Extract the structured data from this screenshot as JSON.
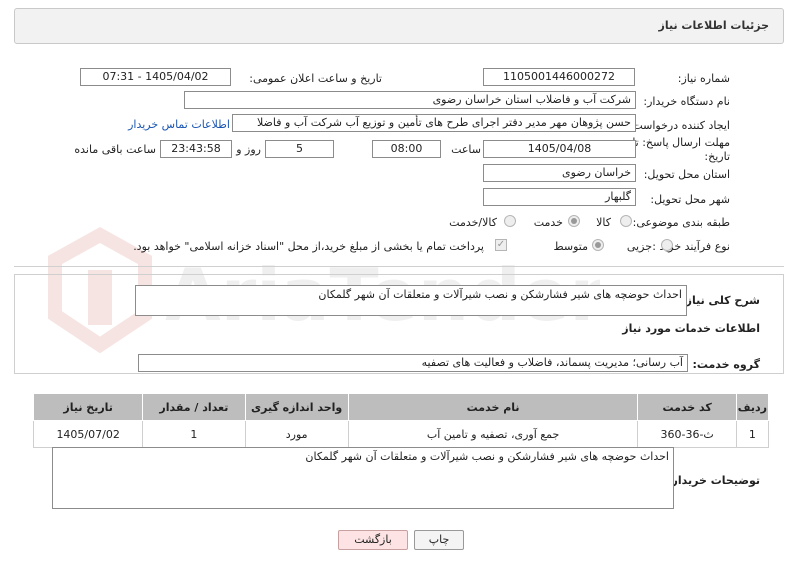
{
  "page_title": "جزئیات اطلاعات نیاز",
  "fields": {
    "need_number_label": "شماره نیاز:",
    "need_number": "1105001446000272",
    "announce_label": "تاریخ و ساعت اعلان عمومی:",
    "announce_value": "1405/04/02 - 07:31",
    "buyer_org_label": "نام دستگاه خریدار:",
    "buyer_org": "شرکت آب و فاضلاب استان خراسان رضوی",
    "creator_label": "ایجاد کننده درخواست:",
    "creator": "حسن پژوهان مهر مدیر دفتر اجرای طرح های تأمین و توزیع آب  شرکت آب و فاضلا",
    "contact_link": "اطلاعات تماس خریدار",
    "deadline_label": "مهلت ارسال پاسخ: تا تاریخ:",
    "deadline_date": "1405/04/08",
    "time_label": "ساعت",
    "deadline_time": "08:00",
    "days_value": "5",
    "days_label": "روز و",
    "remaining_time": "23:43:58",
    "remaining_label": "ساعت باقی مانده",
    "province_label": "استان محل تحویل:",
    "province": "خراسان رضوی",
    "city_label": "شهر محل تحویل:",
    "city": "گلبهار",
    "category_label": "طبقه بندی موضوعی:",
    "category_options": [
      "کالا",
      "خدمت",
      "کالا/خدمت"
    ],
    "category_selected": "خدمت",
    "process_label": "نوع فرآیند خرید :",
    "process_options": [
      "جزیی",
      "متوسط"
    ],
    "process_selected": "متوسط",
    "payment_note": "پرداخت تمام یا بخشی از مبلغ خرید،از محل \"اسناد خزانه اسلامی\" خواهد بود."
  },
  "summary": {
    "label": "شرح کلی نیاز:",
    "text": "احداث حوضچه های شیر فشارشکن و نصب شیرآلات و متعلقات آن شهر گلمکان"
  },
  "services_heading": "اطلاعات خدمات مورد نیاز",
  "service_group": {
    "label": "گروه خدمت:",
    "value": "آب رسانی؛ مدیریت پسماند، فاضلاب و فعالیت های تصفیه"
  },
  "table": {
    "headers": [
      "ردیف",
      "کد خدمت",
      "نام خدمت",
      "واحد اندازه گیری",
      "تعداد / مقدار",
      "تاریخ نیاز"
    ],
    "rows": [
      [
        "1",
        "ث-36-360",
        "جمع آوری، تصفیه و تامین آب",
        "مورد",
        "1",
        "1405/07/02"
      ]
    ]
  },
  "buyer_notes": {
    "label": "توضیحات خریدار:",
    "text": "احداث حوضچه های شیر فشارشکن و نصب شیرآلات و متعلقات آن شهر گلمکان"
  },
  "buttons": {
    "print": "چاپ",
    "back": "بازگشت"
  },
  "watermark_text": "AriaTender.net"
}
